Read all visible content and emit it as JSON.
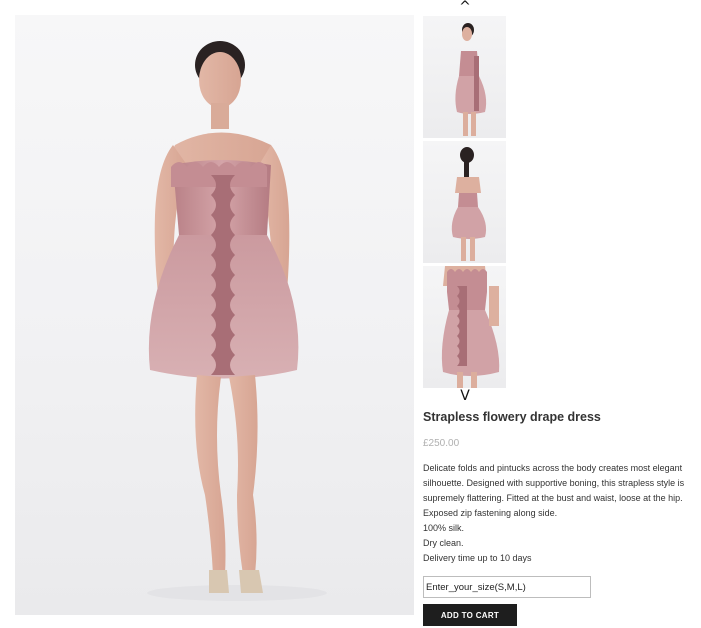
{
  "gallery": {
    "up_arrow": "^",
    "down_arrow": "V"
  },
  "product": {
    "title": "Strapless flowery drape dress",
    "price": "£250.00",
    "description": [
      "Delicate folds and pintucks across the body creates most elegant silhouette. Designed with supportive boning, this strapless style is supremely flattering. Fitted at the bust and waist, loose at the hip. Exposed zip fastening along side.",
      "100% silk.",
      "Dry clean.",
      "Delivery time up to 10 days"
    ]
  },
  "size_field": {
    "placeholder": "Enter_your_size(S,M,L)"
  },
  "cart": {
    "button_label": "ADD TO CART"
  },
  "colors": {
    "dress": "#c9959a",
    "button": "#1e1e1e"
  }
}
